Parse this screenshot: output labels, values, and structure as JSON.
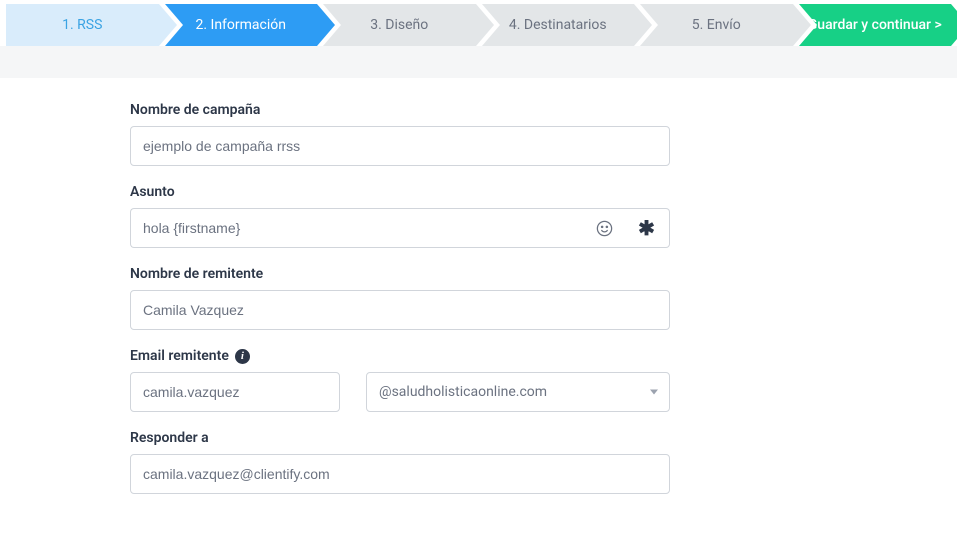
{
  "wizard": {
    "steps": [
      {
        "label": "1. RSS"
      },
      {
        "label": "2. Información"
      },
      {
        "label": "3. Diseño"
      },
      {
        "label": "4. Destinatarios"
      },
      {
        "label": "5. Envío"
      },
      {
        "label": "Guardar y continuar >"
      }
    ]
  },
  "form": {
    "campaign_name": {
      "label": "Nombre de campaña",
      "value": "ejemplo de campaña rrss"
    },
    "subject": {
      "label": "Asunto",
      "value": "hola {firstname}",
      "var_btn": "✱"
    },
    "sender_name": {
      "label": "Nombre de remitente",
      "value": "Camila Vazquez"
    },
    "sender_email": {
      "label": "Email remitente",
      "local_value": "camila.vazquez",
      "domain_selected": "@saludholisticaonline.com"
    },
    "reply_to": {
      "label": "Responder a",
      "value": "camila.vazquez@clientify.com"
    }
  }
}
